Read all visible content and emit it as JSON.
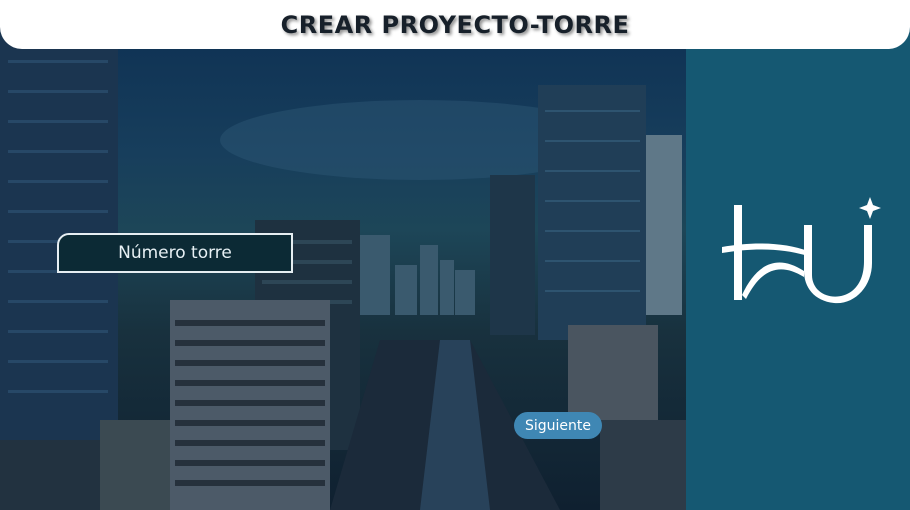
{
  "header": {
    "title": "CREAR PROYECTO-TORRE"
  },
  "form": {
    "tower_number_placeholder": "Número torre",
    "next_button_label": "Siguiente"
  },
  "colors": {
    "header_bg": "#ffffff",
    "right_panel_bg": "#155872",
    "button_bg": "#3f87b4"
  },
  "logo": {
    "icon": "hu-monogram-logo"
  },
  "background": {
    "image": "city-skyline-photo"
  }
}
